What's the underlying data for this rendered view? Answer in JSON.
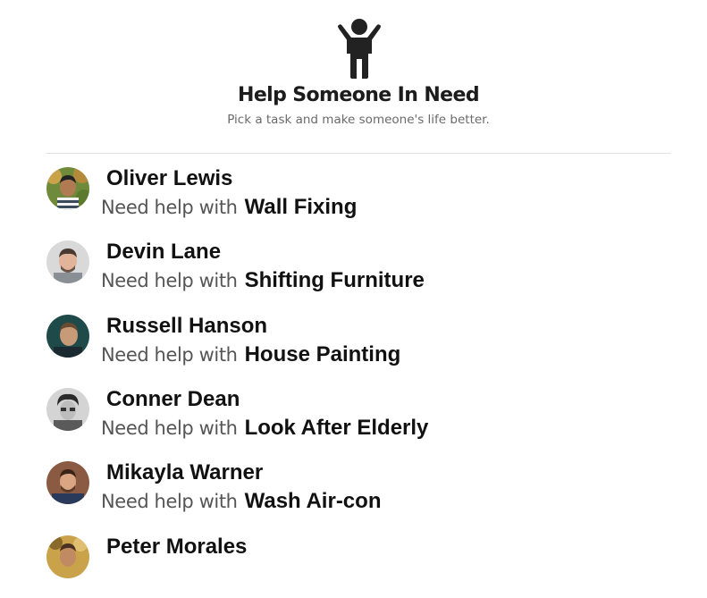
{
  "header": {
    "icon": "person-arms-up-icon",
    "title": "Help Someone In Need",
    "subtitle": "Pick a task and make someone's life better."
  },
  "requests": [
    {
      "name": "Oliver Lewis",
      "prefix": "Need help with",
      "task": "Wall Fixing",
      "avatar": "avatar-photo"
    },
    {
      "name": "Devin Lane",
      "prefix": "Need help with",
      "task": "Shifting Furniture",
      "avatar": "avatar-photo"
    },
    {
      "name": "Russell Hanson",
      "prefix": "Need help with",
      "task": "House Painting",
      "avatar": "avatar-photo"
    },
    {
      "name": "Conner Dean",
      "prefix": "Need help with",
      "task": "Look After Elderly",
      "avatar": "avatar-photo"
    },
    {
      "name": "Mikayla Warner",
      "prefix": "Need help with",
      "task": "Wash Air-con",
      "avatar": "avatar-photo"
    },
    {
      "name": "Peter Morales",
      "prefix": "",
      "task": "",
      "avatar": "avatar-photo"
    }
  ]
}
